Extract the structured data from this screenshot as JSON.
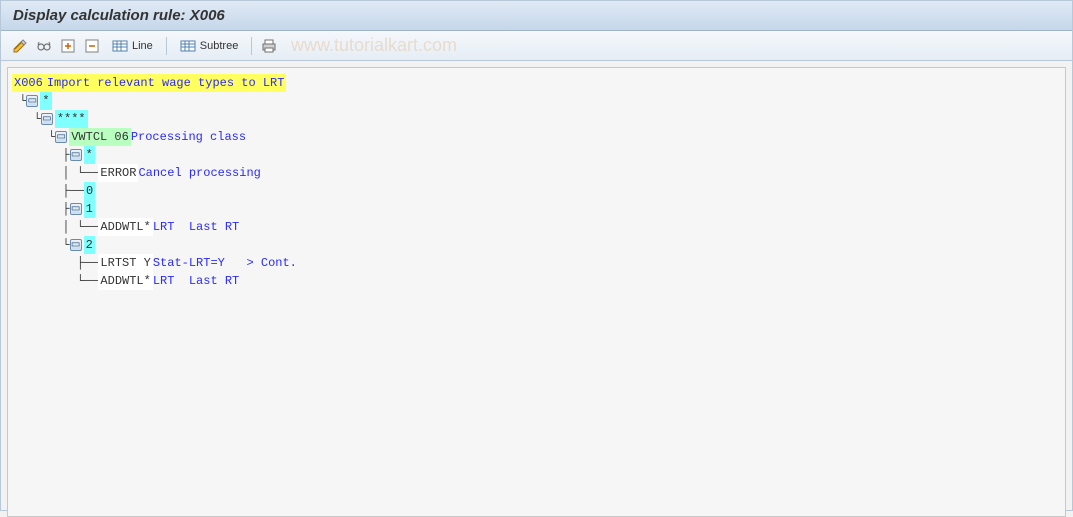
{
  "title": "Display calculation rule: X006",
  "watermark": "www.tutorialkart.com",
  "toolbar": {
    "line_label": "Line",
    "subtree_label": "Subtree"
  },
  "tree": {
    "root_code": "X006",
    "root_text": "Import relevant wage types to LRT",
    "n0": "*",
    "n1": "****",
    "vwtcl_code": "VWTCL 06",
    "vwtcl_text": "Processing class",
    "star": "*",
    "error_code": "ERROR",
    "error_text": "Cancel processing",
    "zero": "0",
    "one": "1",
    "addwtl1_code": "ADDWTL*",
    "addwtl1_text": "LRT  Last RT",
    "two": "2",
    "lrtst_code": "LRTST Y",
    "lrtst_text": "Stat-LRT=Y   > Cont.",
    "addwtl2_code": "ADDWTL*",
    "addwtl2_text": "LRT  Last RT"
  }
}
